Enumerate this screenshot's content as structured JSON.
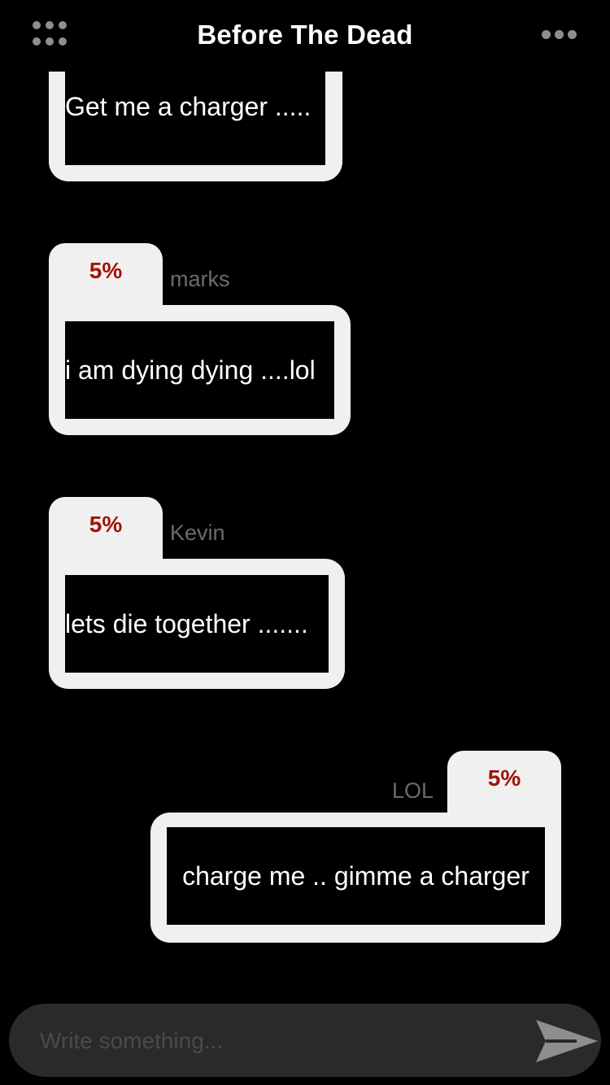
{
  "header": {
    "title": "Before The Dead",
    "menu_icon": "grid-menu-icon",
    "more_icon": "more-dots-icon"
  },
  "messages": [
    {
      "text": "Get me a charger .....",
      "sender": "",
      "battery": ""
    },
    {
      "text": "i am dying dying ....lol",
      "sender": "marks",
      "battery": "5%"
    },
    {
      "text": "lets die together .......",
      "sender": "Kevin",
      "battery": "5%"
    },
    {
      "text": "charge me .. gimme a charger",
      "sender": "LOL",
      "battery": "5%"
    }
  ],
  "composer": {
    "placeholder": "Write something...",
    "value": "",
    "send_icon": "send-arrow-icon"
  },
  "colors": {
    "background": "#000000",
    "bubble": "#f0f0f0",
    "battery_text": "#a01408",
    "sender_text": "#6b6b6b",
    "composer_bg": "#2a2a2a"
  }
}
